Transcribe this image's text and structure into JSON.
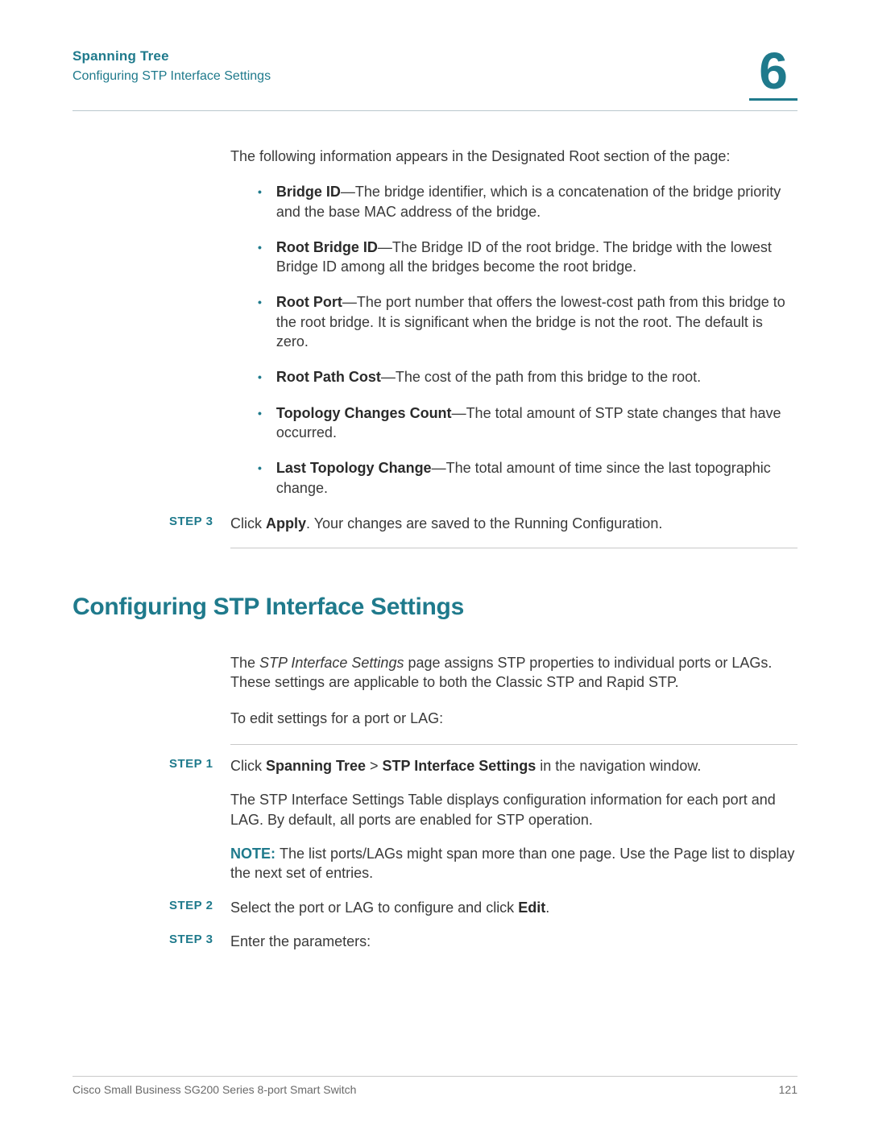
{
  "header": {
    "title": "Spanning Tree",
    "subtitle": "Configuring STP Interface Settings",
    "chapter": "6"
  },
  "intro_para": "The following information appears in the Designated Root section of the page:",
  "bullets": [
    {
      "bold": "Bridge ID",
      "rest": "—The bridge identifier, which is a concatenation of the bridge priority and the base MAC address of the bridge."
    },
    {
      "bold": "Root Bridge ID",
      "rest": "—The Bridge ID of the root bridge. The bridge with the lowest Bridge ID among all the bridges become the root bridge."
    },
    {
      "bold": "Root Port",
      "rest": "—The port number that offers the lowest-cost path from this bridge to the root bridge. It is significant when the bridge is not the root. The default is zero."
    },
    {
      "bold": "Root Path Cost",
      "rest": "—The cost of the path from this bridge to the root."
    },
    {
      "bold": "Topology Changes Count",
      "rest": "—The total amount of STP state changes that have occurred."
    },
    {
      "bold": "Last Topology Change",
      "rest": "—The total amount of time since the last topographic change."
    }
  ],
  "step3_top": {
    "label": "STEP  3",
    "pre": "Click ",
    "bold": "Apply",
    "post": ". Your changes are saved to the Running Configuration."
  },
  "section_heading": "Configuring STP Interface Settings",
  "section_para1_pre": "The ",
  "section_para1_italic": "STP Interface Settings",
  "section_para1_post": " page assigns STP properties to individual ports or LAGs. These settings are applicable to both the Classic STP and Rapid STP.",
  "section_para2": "To edit settings for a port or LAG:",
  "steps": {
    "s1": {
      "label": "STEP  1",
      "pre": "Click ",
      "b1": "Spanning Tree",
      "mid": " > ",
      "b2": "STP Interface Settings",
      "post": " in the navigation window."
    },
    "s1_body": "The STP Interface Settings Table displays configuration information for each port and LAG. By default, all ports are enabled for STP operation.",
    "s1_note_lead": "NOTE: ",
    "s1_note_rest": "The list ports/LAGs might span more than one page. Use the Page list to display the next set of entries.",
    "s2": {
      "label": "STEP  2",
      "pre": "Select the port or LAG to configure and click ",
      "bold": "Edit",
      "post": "."
    },
    "s3": {
      "label": "STEP  3",
      "text": "Enter the parameters:"
    }
  },
  "footer": {
    "left": "Cisco Small Business SG200 Series 8-port Smart Switch",
    "right": "121"
  }
}
